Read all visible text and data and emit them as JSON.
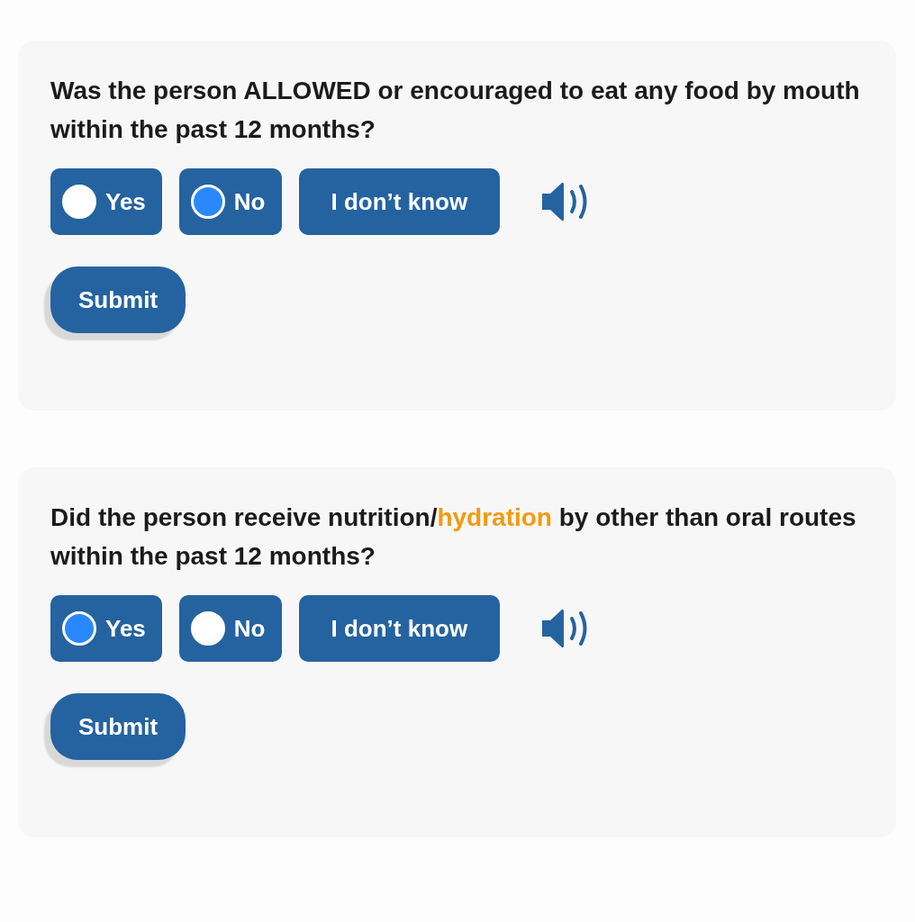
{
  "questions": [
    {
      "question_parts": [
        {
          "text": "Was the person ALLOWED or encouraged to eat any food by mouth within the past 12 months?",
          "highlighted": false
        }
      ],
      "options": [
        {
          "label": "Yes",
          "kind": "radio",
          "selected": false
        },
        {
          "label": "No",
          "kind": "radio",
          "selected": true
        },
        {
          "label": "I don’t know",
          "kind": "plain",
          "selected": false
        }
      ],
      "submit": "Submit"
    },
    {
      "question_parts": [
        {
          "text": "Did the person receive nutrition/",
          "highlighted": false
        },
        {
          "text": "hydration",
          "highlighted": true
        },
        {
          "text": " by other than oral routes within the past 12 months?",
          "highlighted": false
        }
      ],
      "options": [
        {
          "label": "Yes",
          "kind": "radio",
          "selected": true
        },
        {
          "label": "No",
          "kind": "radio",
          "selected": false
        },
        {
          "label": "I don’t know",
          "kind": "plain",
          "selected": false
        }
      ],
      "submit": "Submit"
    }
  ]
}
